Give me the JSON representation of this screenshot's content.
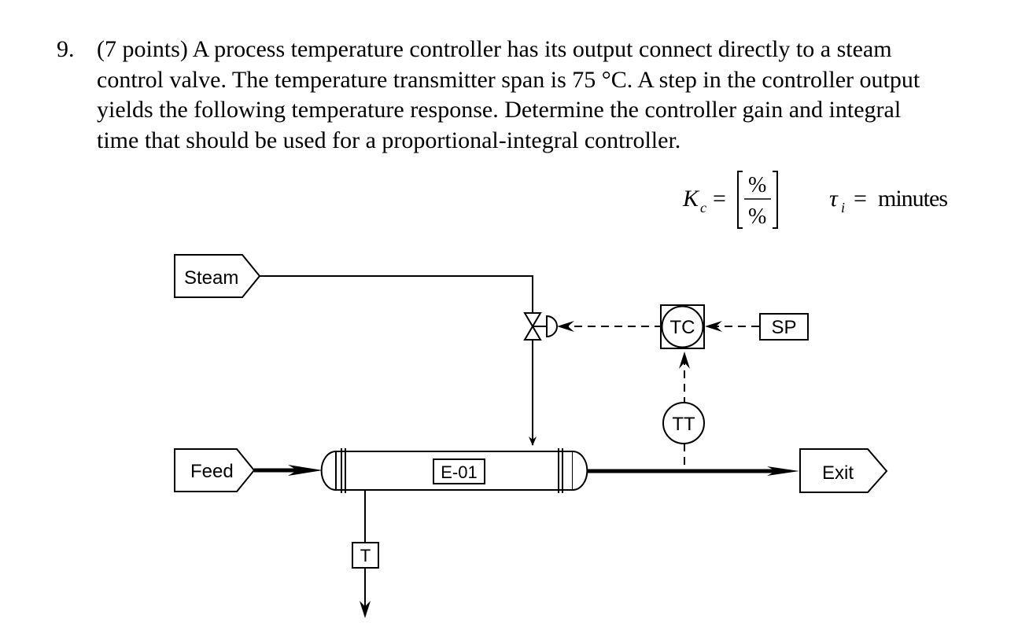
{
  "problem": {
    "number": "9.",
    "lines": [
      "(7 points)  A process temperature controller has its output connect directly to a steam",
      "control valve.  The temperature transmitter span is 75 °C.  A step in the controller output",
      "yields the following temperature response.  Determine the controller gain and integral",
      "time that should be used for a proportional-integral controller."
    ]
  },
  "answers": {
    "kc": {
      "symbol": "K",
      "subscript": "c",
      "equals": "=",
      "unit_numerator": "%",
      "unit_denominator": "%"
    },
    "taui": {
      "symbol": "τ",
      "subscript": "i",
      "equals": "=",
      "unit": "minutes"
    }
  },
  "diagram": {
    "streams": {
      "steam": "Steam",
      "feed": "Feed",
      "exit": "Exit"
    },
    "equipment": {
      "exchanger": "E-01",
      "trap": "T"
    },
    "instruments": {
      "controller": "TC",
      "transmitter": "TT",
      "setpoint": "SP"
    }
  }
}
